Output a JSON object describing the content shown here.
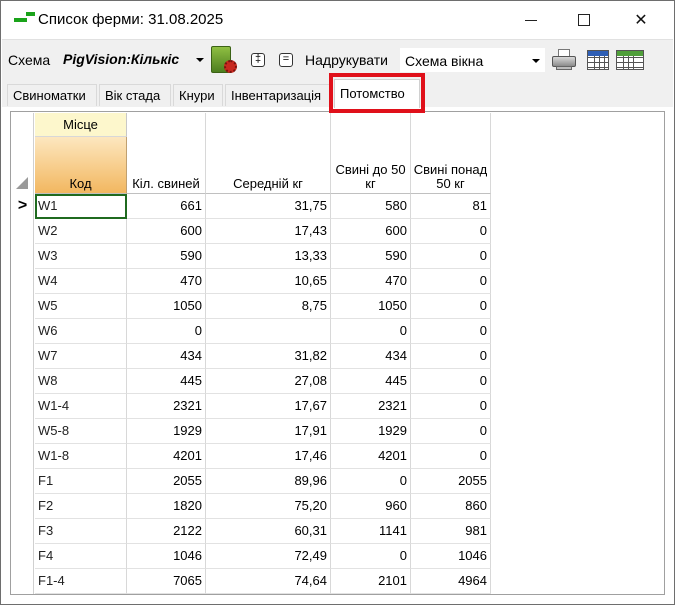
{
  "window": {
    "title": "Список ферми: 31.08.2025"
  },
  "toolbar": {
    "scheme_label": "Схема",
    "scheme_value": "PigVision:Кількіс",
    "expand_symbol": "‡",
    "collapse_symbol": "=",
    "print_label": "Надрукувати",
    "view_combo_value": "Схема вікна",
    "icons": [
      "book-gear-icon",
      "printer-icon",
      "calendar-grid-icon",
      "table-grid-icon"
    ]
  },
  "tabs": [
    {
      "label": "Свиноматки",
      "active": false
    },
    {
      "label": "Вік стада",
      "active": false
    },
    {
      "label": "Кнури",
      "active": false
    },
    {
      "label": "Інвентаризація",
      "active": false
    },
    {
      "label": "Потомство",
      "active": true
    }
  ],
  "grid": {
    "group_header": "Місце",
    "columns": [
      "Код",
      "Кіл. свиней",
      "Середній кг",
      "Свині до 50 кг",
      "Свині понад 50 кг"
    ],
    "current_row_marker": ">",
    "rows": [
      {
        "code": "W1",
        "count": "661",
        "avg_kg": "31,75",
        "under50": "580",
        "over50": "81"
      },
      {
        "code": "W2",
        "count": "600",
        "avg_kg": "17,43",
        "under50": "600",
        "over50": "0"
      },
      {
        "code": "W3",
        "count": "590",
        "avg_kg": "13,33",
        "under50": "590",
        "over50": "0"
      },
      {
        "code": "W4",
        "count": "470",
        "avg_kg": "10,65",
        "under50": "470",
        "over50": "0"
      },
      {
        "code": "W5",
        "count": "1050",
        "avg_kg": "8,75",
        "under50": "1050",
        "over50": "0"
      },
      {
        "code": "W6",
        "count": "0",
        "avg_kg": "",
        "under50": "0",
        "over50": "0"
      },
      {
        "code": "W7",
        "count": "434",
        "avg_kg": "31,82",
        "under50": "434",
        "over50": "0"
      },
      {
        "code": "W8",
        "count": "445",
        "avg_kg": "27,08",
        "under50": "445",
        "over50": "0"
      },
      {
        "code": "W1-4",
        "count": "2321",
        "avg_kg": "17,67",
        "under50": "2321",
        "over50": "0"
      },
      {
        "code": "W5-8",
        "count": "1929",
        "avg_kg": "17,91",
        "under50": "1929",
        "over50": "0"
      },
      {
        "code": "W1-8",
        "count": "4201",
        "avg_kg": "17,46",
        "under50": "4201",
        "over50": "0"
      },
      {
        "code": "F1",
        "count": "2055",
        "avg_kg": "89,96",
        "under50": "0",
        "over50": "2055"
      },
      {
        "code": "F2",
        "count": "1820",
        "avg_kg": "75,20",
        "under50": "960",
        "over50": "860"
      },
      {
        "code": "F3",
        "count": "2122",
        "avg_kg": "60,31",
        "under50": "1141",
        "over50": "981"
      },
      {
        "code": "F4",
        "count": "1046",
        "avg_kg": "72,49",
        "under50": "0",
        "over50": "1046"
      },
      {
        "code": "F1-4",
        "count": "7065",
        "avg_kg": "74,64",
        "under50": "2101",
        "over50": "4964"
      }
    ]
  },
  "colors": {
    "highlight": "#e0101a",
    "key_header": "#f2b760",
    "group_header": "#fdf7cc",
    "selected_cell": "#1f6a1f"
  }
}
